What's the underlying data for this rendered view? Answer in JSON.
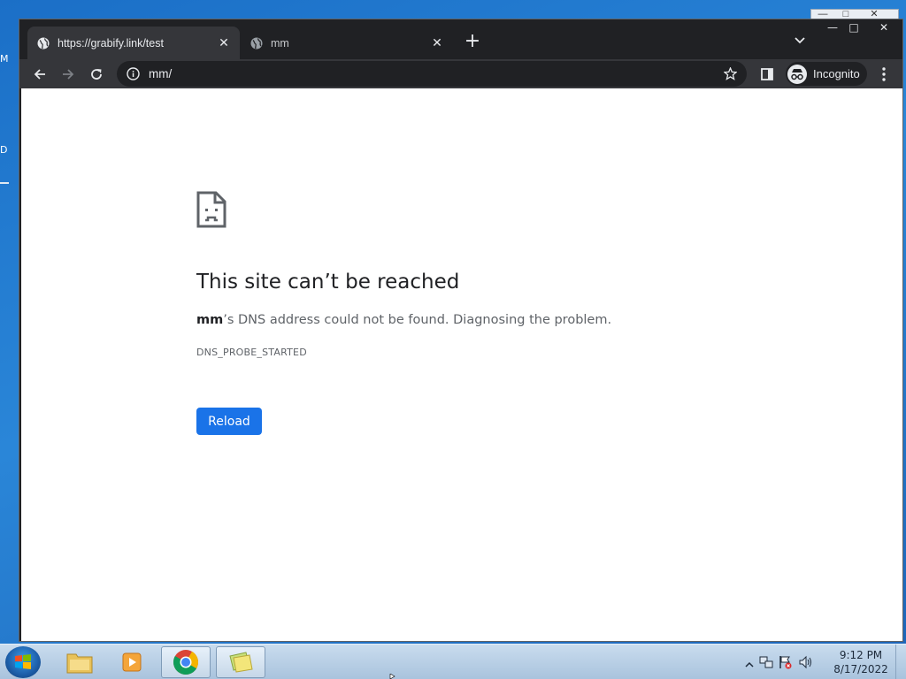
{
  "desktop": {
    "edge_glyphs": [
      "M",
      "D"
    ]
  },
  "browser": {
    "tabs": [
      {
        "title": "https://grabify.link/test",
        "icon": "globe-icon",
        "active": true
      },
      {
        "title": "mm",
        "icon": "globe-icon",
        "active": false
      }
    ],
    "new_tab_label": "+",
    "address": "mm/",
    "profile_label": "Incognito",
    "window_controls": [
      "minimize",
      "maximize",
      "close"
    ]
  },
  "error_page": {
    "title": "This site can’t be reached",
    "host": "mm",
    "description_rest": "’s DNS address could not be found. Diagnosing the problem.",
    "error_code": "DNS_PROBE_STARTED",
    "reload_label": "Reload"
  },
  "taskbar": {
    "apps": [
      "file-explorer",
      "media-player",
      "chrome",
      "sticky-notes"
    ],
    "clock_time": "9:12 PM",
    "clock_date": "8/17/2022"
  },
  "colors": {
    "accent": "#1a73e8",
    "tab_strip": "#202124",
    "toolbar": "#35363a"
  }
}
